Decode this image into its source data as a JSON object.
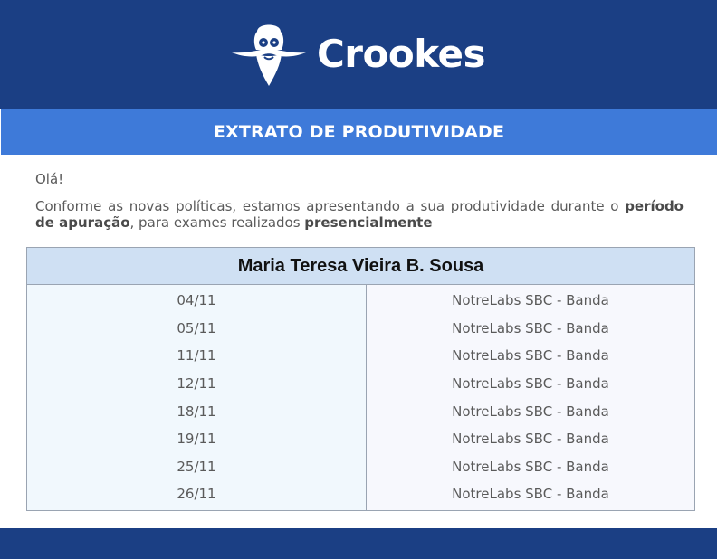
{
  "header": {
    "brand_name": "Crookes",
    "logo_icon": "bearded-scientist-logo-icon",
    "background_color": "#1b3f84"
  },
  "banner": {
    "title": "EXTRATO DE PRODUTIVIDADE",
    "background_color": "#3e7ad9"
  },
  "message": {
    "greeting": "Olá!",
    "intro_part1": "Conforme as novas políticas, estamos apresentando a sua produtividade durante o ",
    "intro_bold1": "período de apuração",
    "intro_part2": ", para exames realizados ",
    "intro_bold2": "presencialmente"
  },
  "table": {
    "patient_name": "Maria Teresa Vieira B. Sousa",
    "rows": [
      {
        "date": "04/11",
        "location": "NotreLabs SBC - Banda"
      },
      {
        "date": "05/11",
        "location": "NotreLabs SBC - Banda"
      },
      {
        "date": "11/11",
        "location": "NotreLabs SBC - Banda"
      },
      {
        "date": "12/11",
        "location": "NotreLabs SBC - Banda"
      },
      {
        "date": "18/11",
        "location": "NotreLabs SBC - Banda"
      },
      {
        "date": "19/11",
        "location": "NotreLabs SBC - Banda"
      },
      {
        "date": "25/11",
        "location": "NotreLabs SBC - Banda"
      },
      {
        "date": "26/11",
        "location": "NotreLabs SBC - Banda"
      }
    ]
  }
}
